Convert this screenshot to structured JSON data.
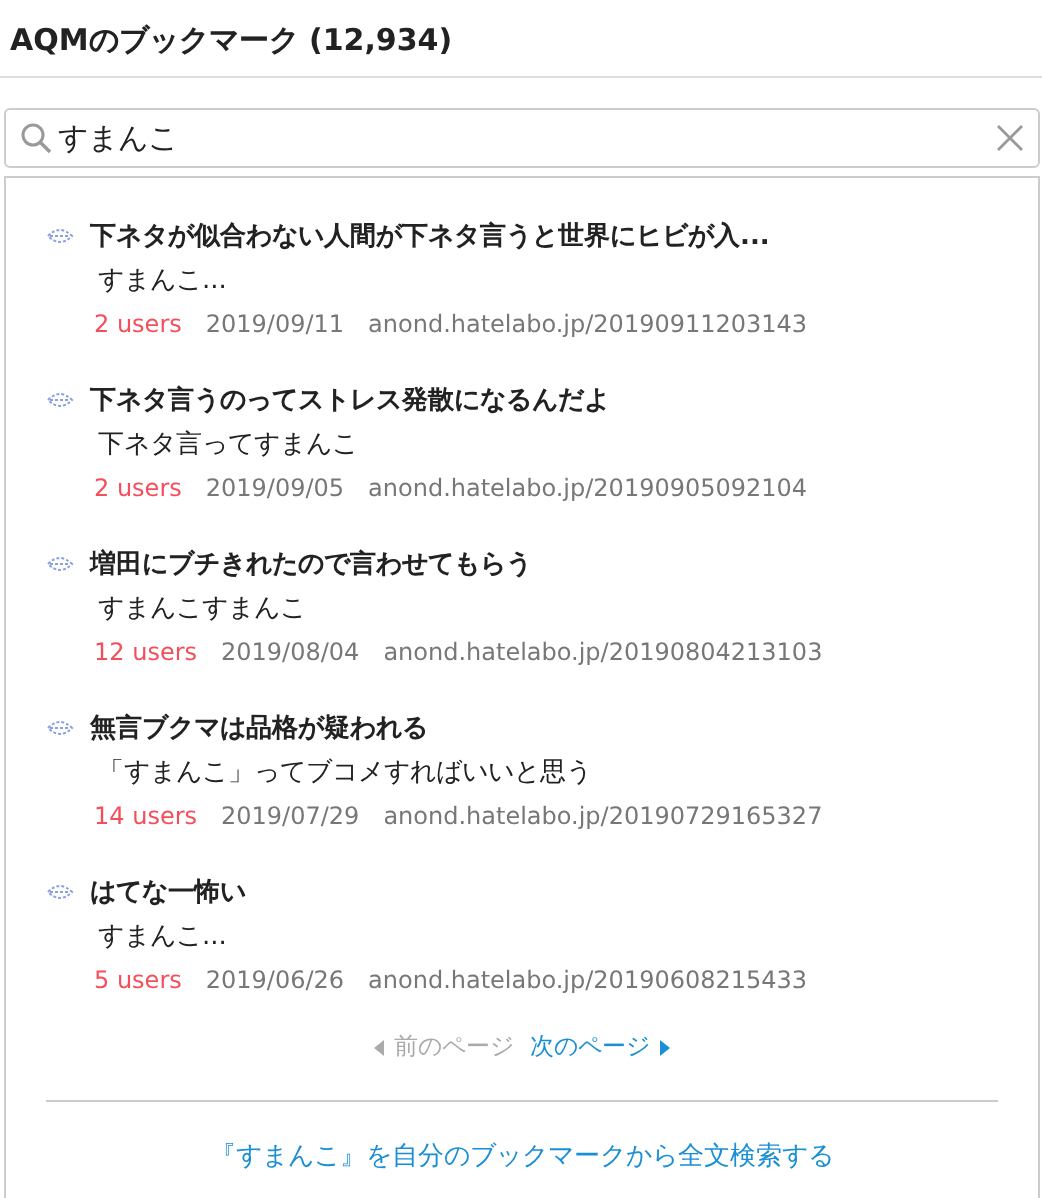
{
  "header": {
    "title": "AQMのブックマーク (12,934)"
  },
  "search": {
    "value": "すまんこ"
  },
  "results": [
    {
      "title": "下ネタが似合わない人間が下ネタ言うと世界にヒビが入...",
      "comment": "すまんこ...",
      "users": "2 users",
      "date": "2019/09/11",
      "url": "anond.hatelabo.jp/20190911203143"
    },
    {
      "title": "下ネタ言うのってストレス発散になるんだよ",
      "comment": "下ネタ言ってすまんこ",
      "users": "2 users",
      "date": "2019/09/05",
      "url": "anond.hatelabo.jp/20190905092104"
    },
    {
      "title": "増田にブチきれたので言わせてもらう",
      "comment": "すまんこすまんこ",
      "users": "12 users",
      "date": "2019/08/04",
      "url": "anond.hatelabo.jp/20190804213103"
    },
    {
      "title": "無言ブクマは品格が疑われる",
      "comment": "「すまんこ」ってブコメすればいいと思う",
      "users": "14 users",
      "date": "2019/07/29",
      "url": "anond.hatelabo.jp/20190729165327"
    },
    {
      "title": "はてな一怖い",
      "comment": "すまんこ...",
      "users": "5 users",
      "date": "2019/06/26",
      "url": "anond.hatelabo.jp/20190608215433"
    }
  ],
  "pagination": [
    {
      "label": "前のページ",
      "kind": "prev",
      "disabled": true
    },
    {
      "label": "次のページ",
      "kind": "next",
      "disabled": false
    }
  ],
  "fulltext_link": "『すまんこ』を自分のブックマークから全文検索する"
}
